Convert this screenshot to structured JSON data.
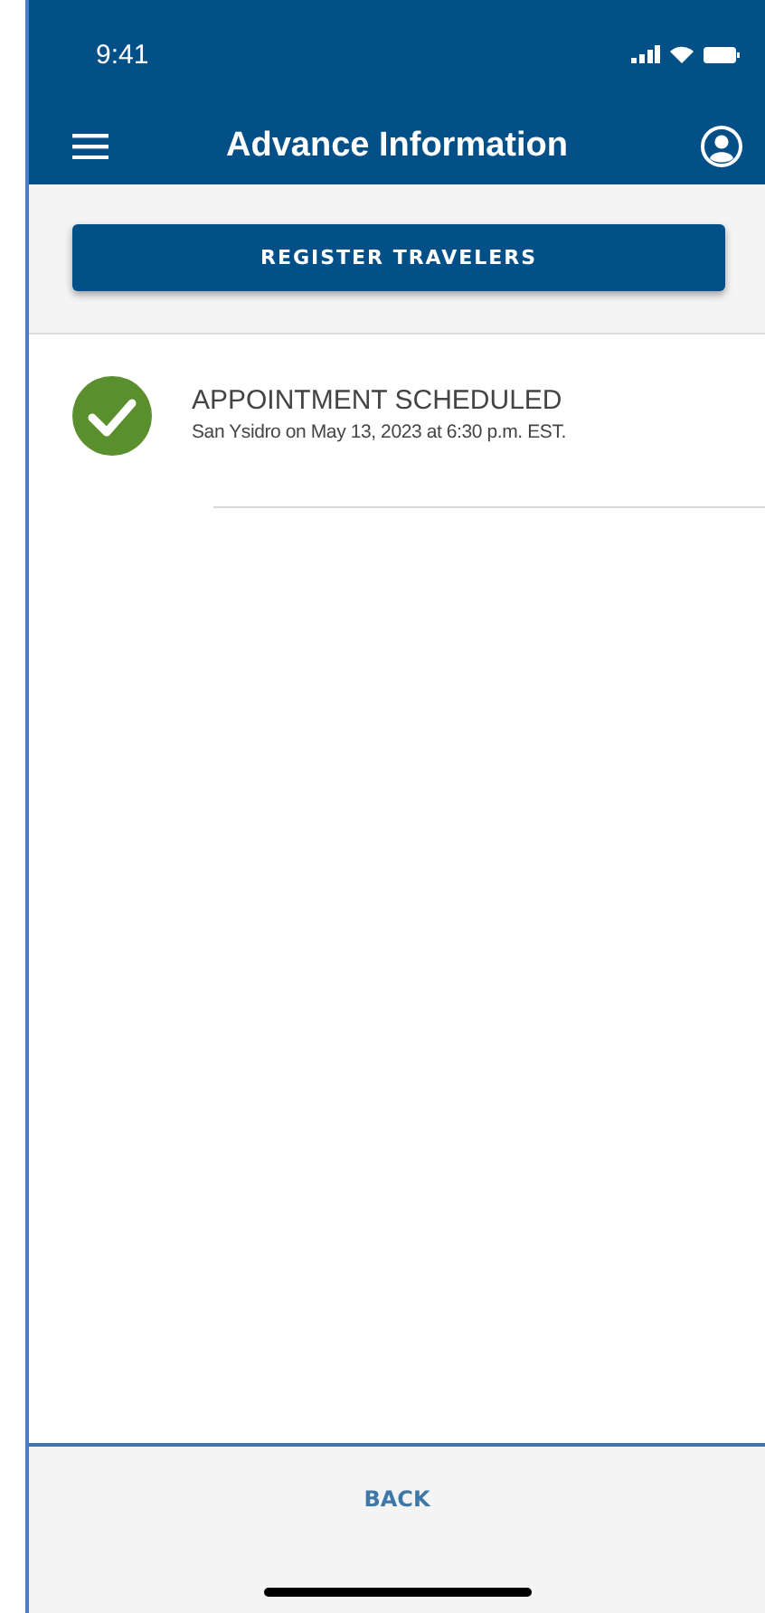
{
  "status_bar": {
    "time": "9:41"
  },
  "header": {
    "title": "Advance Information"
  },
  "register_button": {
    "label": "REGISTER TRAVELERS"
  },
  "notices": [
    {
      "kind": "confirmed",
      "title": "APPOINTMENT SCHEDULED",
      "detail": "San Ysidro on May 13, 2023 at 6:30 p.m. EST."
    }
  ],
  "back_button": {
    "label": "BACK"
  }
}
